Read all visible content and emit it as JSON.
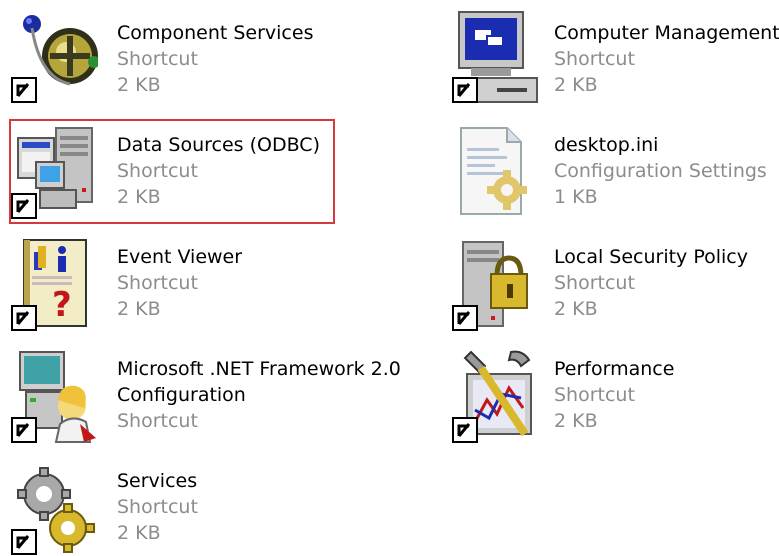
{
  "files": [
    {
      "name": "Component Services",
      "type": "Shortcut",
      "size": "2 KB",
      "icon": "component-services-icon"
    },
    {
      "name": "Computer Management",
      "type": "Shortcut",
      "size": "2 KB",
      "icon": "computer-management-icon"
    },
    {
      "name": "Data Sources (ODBC)",
      "type": "Shortcut",
      "size": "2 KB",
      "icon": "data-sources-icon",
      "highlighted": true
    },
    {
      "name": "desktop.ini",
      "type": "Configuration Settings",
      "size": "1 KB",
      "icon": "config-settings-icon"
    },
    {
      "name": "Event Viewer",
      "type": "Shortcut",
      "size": "2 KB",
      "icon": "event-viewer-icon"
    },
    {
      "name": "Local Security Policy",
      "type": "Shortcut",
      "size": "2 KB",
      "icon": "local-security-policy-icon"
    },
    {
      "name": "Microsoft .NET Framework 2.0",
      "name_line2": "Configuration",
      "type": "Shortcut",
      "icon": "net-framework-config-icon"
    },
    {
      "name": "Performance",
      "type": "Shortcut",
      "size": "2 KB",
      "icon": "performance-icon"
    },
    {
      "name": "Services",
      "type": "Shortcut",
      "size": "2 KB",
      "icon": "services-icon"
    }
  ],
  "highlight_color": "#d43a3a",
  "secondary_text_color": "#8c8c8c"
}
